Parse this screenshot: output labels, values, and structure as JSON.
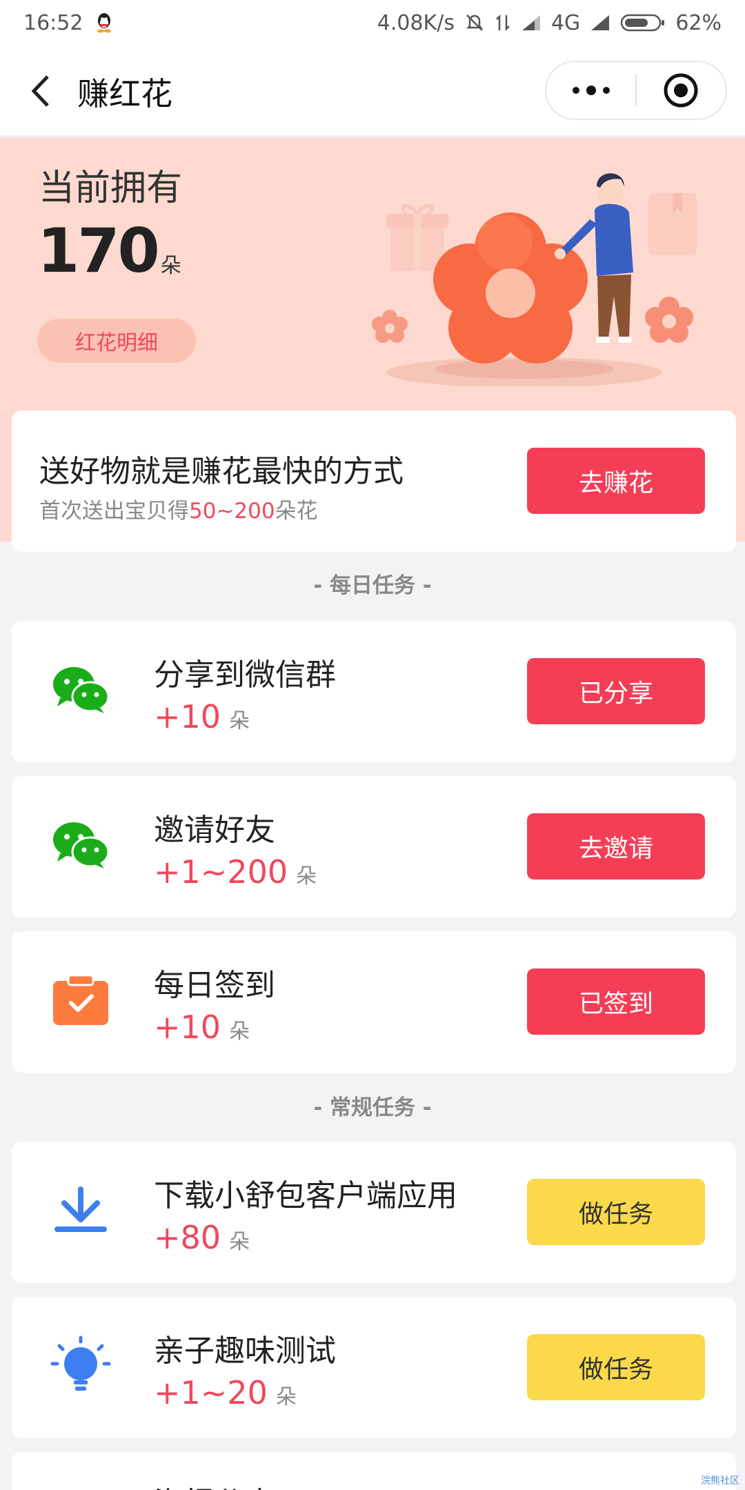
{
  "status_bar": {
    "time": "16:52",
    "net_speed": "4.08K/s",
    "network": "4G",
    "battery": "62%"
  },
  "nav": {
    "title": "赚红花"
  },
  "hero": {
    "label": "当前拥有",
    "count": "170",
    "unit": "朵",
    "detail_button": "红花明细"
  },
  "promo": {
    "title": "送好物就是赚花最快的方式",
    "subtitle_prefix": "首次送出宝贝得",
    "subtitle_highlight": "50~200",
    "subtitle_suffix": "朵花",
    "button": "去赚花"
  },
  "sections": {
    "daily": "- 每日任务 -",
    "regular": "- 常规任务 -"
  },
  "tasks": [
    {
      "name": "分享到微信群",
      "points": "+10",
      "unit": "朵",
      "button": "已分享",
      "icon": "wechat-icon"
    },
    {
      "name": "邀请好友",
      "points": "+1~200",
      "unit": "朵",
      "button": "去邀请",
      "icon": "wechat-icon"
    },
    {
      "name": "每日签到",
      "points": "+10",
      "unit": "朵",
      "button": "已签到",
      "icon": "calendar-check-icon"
    },
    {
      "name": "下载小舒包客户端应用",
      "points": "+80",
      "unit": "朵",
      "button": "做任务",
      "icon": "download-icon"
    },
    {
      "name": "亲子趣味测试",
      "points": "+1~20",
      "unit": "朵",
      "button": "做任务",
      "icon": "lightbulb-icon"
    },
    {
      "name": "海报分享",
      "points": "",
      "unit": "",
      "button": "",
      "icon": ""
    }
  ],
  "colors": {
    "accent_red": "#f43e56",
    "accent_yellow": "#fbd94b",
    "hero_bg": "#fdd9cf",
    "wechat_green": "#1aad19",
    "icon_blue": "#3d7ff0",
    "icon_orange": "#ff7a3d"
  },
  "watermark": "浣熊社区"
}
